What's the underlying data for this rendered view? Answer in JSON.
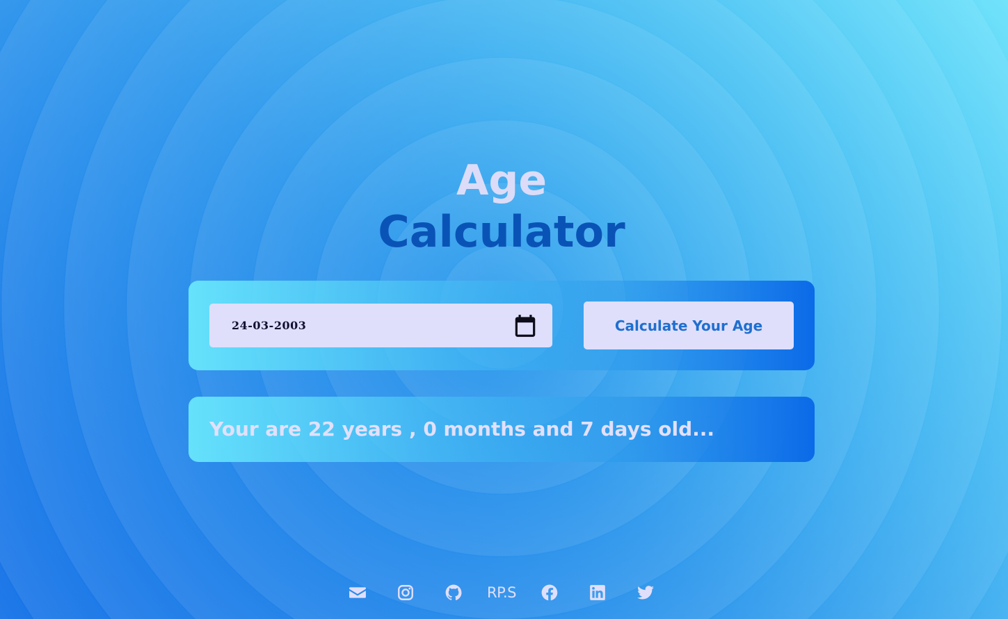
{
  "title": {
    "line1": "Age",
    "line2": "Calculator"
  },
  "form": {
    "date_value": "24-03-2003",
    "calendar_icon": "calendar-icon",
    "button_label": "Calculate Your Age"
  },
  "result": {
    "text": "Your are 22 years , 0 months and 7 days old..."
  },
  "footer": {
    "links": [
      {
        "icon": "envelope-icon"
      },
      {
        "icon": "instagram-icon"
      },
      {
        "icon": "github-icon"
      },
      {
        "label": "RP.S"
      },
      {
        "icon": "facebook-icon"
      },
      {
        "icon": "linkedin-icon"
      },
      {
        "icon": "twitter-icon"
      }
    ]
  },
  "colors": {
    "title_line1": "#dcdcf8",
    "title_line2": "#0a53b6",
    "field_bg": "#e0dffb",
    "button_text": "#1f6fd0",
    "icon_color": "#e0dffb"
  }
}
